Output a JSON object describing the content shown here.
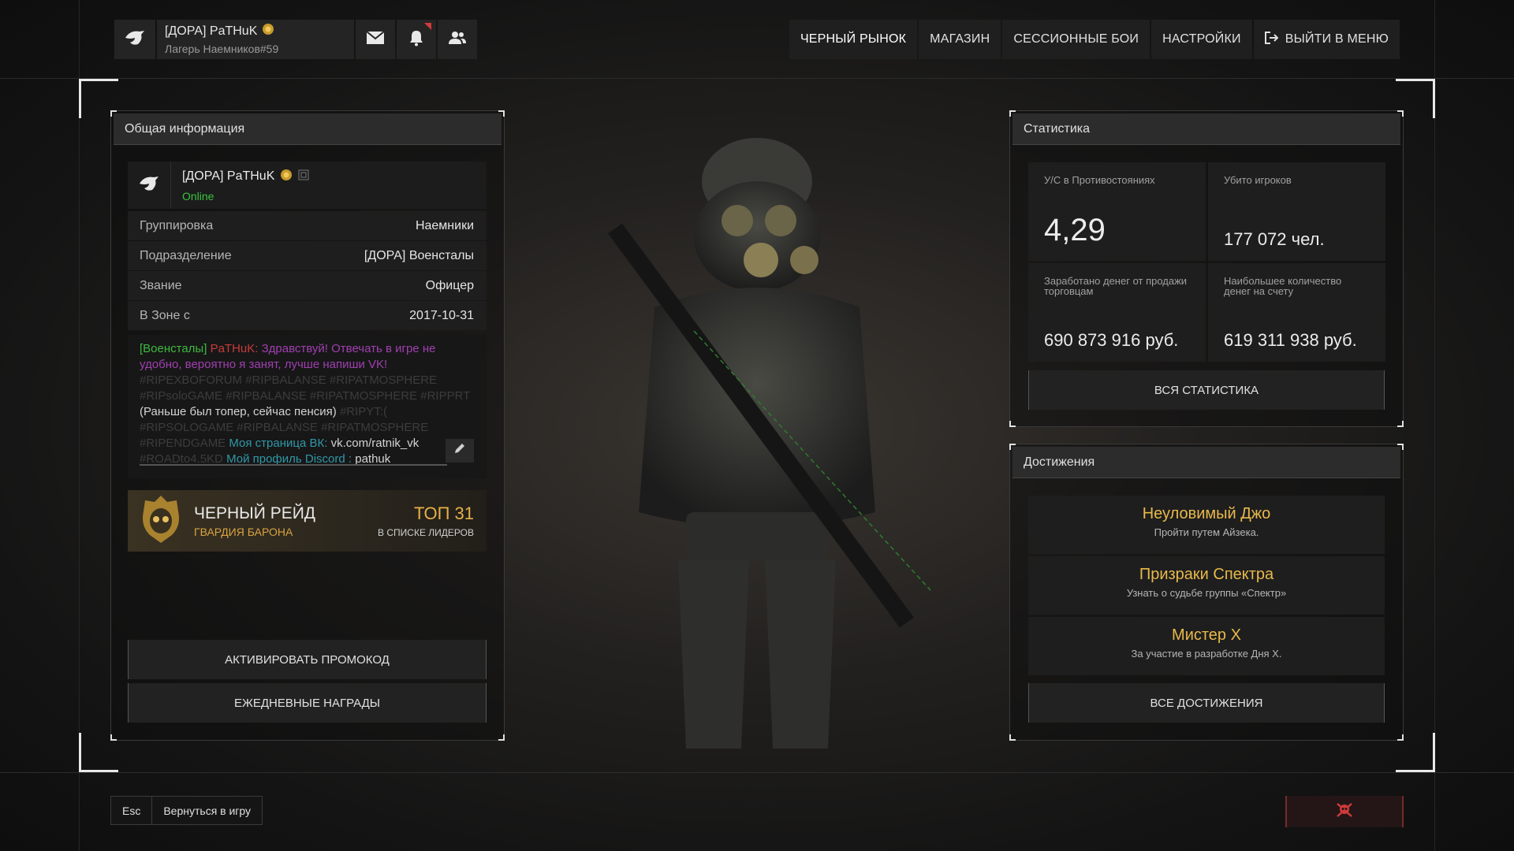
{
  "header": {
    "username": "[ДОРА] PaTHuK",
    "subtitle": "Лагерь Наемников#59",
    "icons": [
      "eagle-logo-icon",
      "mail-icon",
      "bell-icon",
      "friends-icon"
    ]
  },
  "nav": {
    "items": [
      "ЧЕРНЫЙ РЫНОК",
      "МАГАЗИН",
      "СЕССИОННЫЕ БОИ",
      "НАСТРОЙКИ"
    ],
    "exit_label": "ВЫЙТИ В МЕНЮ"
  },
  "info": {
    "title": "Общая информация",
    "name": "[ДОРА] PaTHuK",
    "status": "Online",
    "rows": [
      {
        "key": "Группировка",
        "value": "Наемники"
      },
      {
        "key": "Подразделение",
        "value": "[ДОРА] Военсталы"
      },
      {
        "key": "Звание",
        "value": "Офицер"
      },
      {
        "key": "В Зоне с",
        "value": "2017-10-31"
      }
    ],
    "bio": {
      "clan": "[Военсталы]",
      "nick": "PaTHuK:",
      "greeting": "Здравствуй! Отвечать в игре не удобно, вероятно я занят, лучше напиши VK!",
      "tags1": "#RIPEXBOFORUM #RIPBALANSE #RIPATMOSPHERE #RIPsoloGAME #RIPBALANSE #RIPATMOSPHERE #RIPPRT",
      "note": "(Раньше был топер, сейчас пенсия)",
      "tags2": "#RIPYT:( #RIPSOLOGAME #RIPBALANSE #RIPATMOSPHERE #RIPENDGAME",
      "vk_label": "Моя страница ВК:",
      "vk_value": "vk.com/ratnik_vk",
      "tags3": "#ROADto4.5KD",
      "discord_label": "Мой профиль Discord :",
      "discord_value": "pathuk"
    },
    "raid": {
      "title": "ЧЕРНЫЙ РЕЙД",
      "subtitle": "ГВАРДИЯ БАРОНА",
      "rank": "ТОП 31",
      "rank_sub": "В СПИСКЕ ЛИДЕРОВ"
    },
    "promo_button": "АКТИВИРОВАТЬ ПРОМОКОД",
    "daily_button": "ЕЖЕДНЕВНЫЕ НАГРАДЫ"
  },
  "stats": {
    "title": "Статистика",
    "items": [
      {
        "label": "У/С в Противостояниях",
        "value": "4,29"
      },
      {
        "label": "Убито игроков",
        "value": "177 072 чел."
      },
      {
        "label": "Заработано денег от продажи торговцам",
        "value": "690 873 916 руб."
      },
      {
        "label": "Наибольшее количество денег на счету",
        "value": "619 311 938 руб."
      }
    ],
    "all_button": "ВСЯ СТАТИСТИКА"
  },
  "achievements": {
    "title": "Достижения",
    "items": [
      {
        "title": "Неуловимый Джо",
        "desc": "Пройти путем Айзека."
      },
      {
        "title": "Призраки Спектра",
        "desc": "Узнать о судьбе группы «Спектр»"
      },
      {
        "title": "Мистер X",
        "desc": "За участие в разработке Дня X."
      }
    ],
    "all_button": "ВСЕ ДОСТИЖЕНИЯ"
  },
  "footer": {
    "esc_key": "Esc",
    "back_label": "Вернуться в игру",
    "skull_icon": "skull-icon"
  },
  "colors": {
    "online": "#39c43d",
    "achievement": "#e8b94a",
    "raid_rank": "#e8b047"
  }
}
